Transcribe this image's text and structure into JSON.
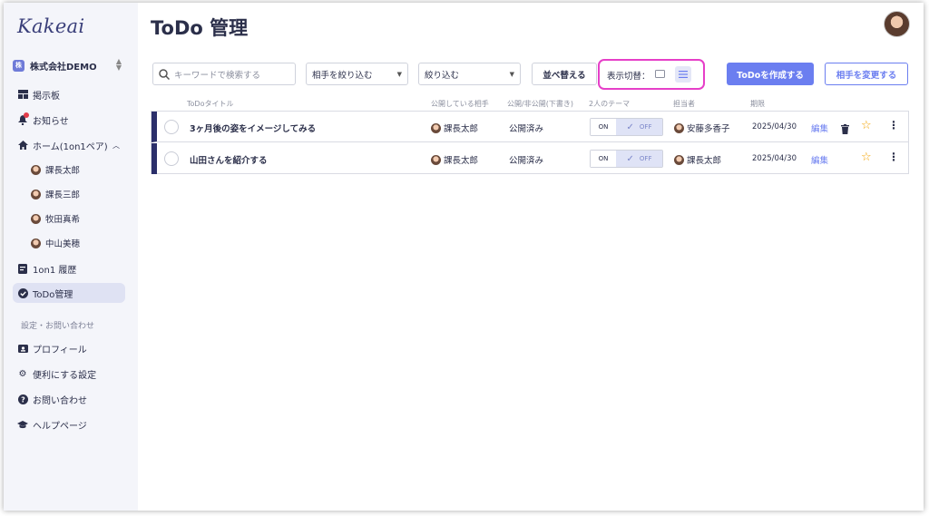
{
  "sidebar": {
    "logo": "Kakeai",
    "company": {
      "badge": "株",
      "name": "株式会社DEMO"
    },
    "items": [
      {
        "label": "掲示板"
      },
      {
        "label": "お知らせ"
      },
      {
        "label": "ホーム(1on1ペア)"
      },
      {
        "label": "課長太郎"
      },
      {
        "label": "課長三郎"
      },
      {
        "label": "牧田真希"
      },
      {
        "label": "中山美穂"
      },
      {
        "label": "1on1 履歴"
      },
      {
        "label": "ToDo管理"
      }
    ],
    "section_label": "設定・お問い合わせ",
    "settings": [
      {
        "label": "プロフィール"
      },
      {
        "label": "便利にする設定"
      },
      {
        "label": "お問い合わせ"
      },
      {
        "label": "ヘルプページ"
      }
    ]
  },
  "header": {
    "title": "ToDo 管理"
  },
  "toolbar": {
    "search_placeholder": "キーワードで検索する",
    "partner_filter": "相手を絞り込む",
    "filter": "絞り込む",
    "sort_label": "並べ替える",
    "view_label": "表示切替：",
    "create_label": "ToDoを作成する",
    "change_partner_label": "相手を変更する"
  },
  "table": {
    "headers": [
      "ToDoタイトル",
      "公開している相手",
      "公開/非公開(下書き)",
      "2人のテーマ",
      "担当者",
      "期限"
    ],
    "rows": [
      {
        "title": "3ヶ月後の姿をイメージしてみる",
        "partner": "課長太郎",
        "status": "公開済み",
        "toggle_on": "ON",
        "toggle_off": "OFF",
        "owner": "安藤多香子",
        "due": "2025/04/30",
        "edit": "編集"
      },
      {
        "title": "山田さんを紹介する",
        "partner": "課長太郎",
        "status": "公開済み",
        "toggle_on": "ON",
        "toggle_off": "OFF",
        "owner": "課長太郎",
        "due": "2025/04/30",
        "edit": "編集"
      }
    ]
  },
  "colors": {
    "accent": "#6b7ef0",
    "highlight": "#e63fc8",
    "row_marker": "#2b2f6a",
    "star": "#f3a300"
  }
}
